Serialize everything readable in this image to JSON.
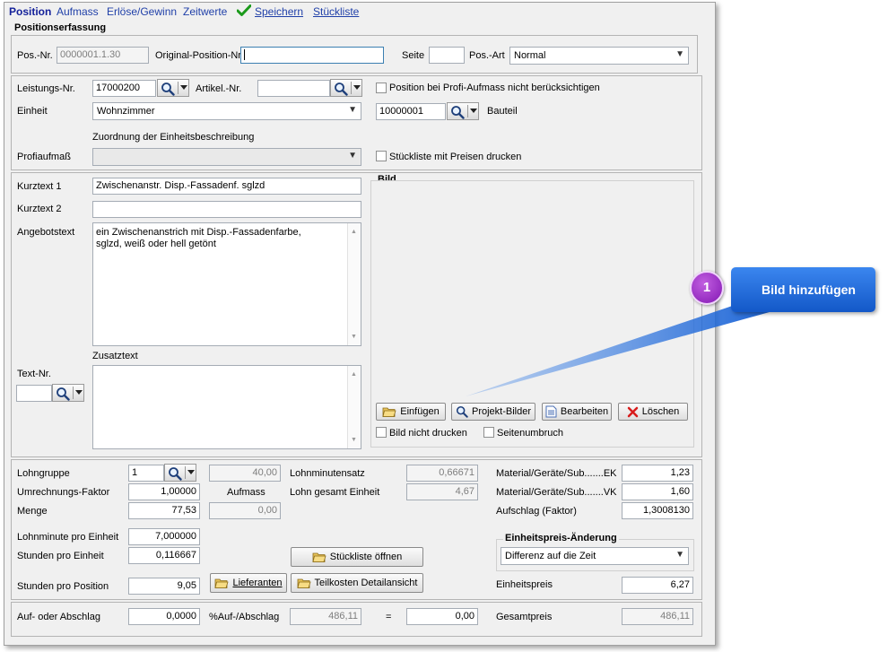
{
  "tabs": {
    "position": "Position",
    "aufmass": "Aufmass",
    "erloese": "Erlöse/Gewinn",
    "zeitwerte": "Zeitwerte",
    "speichern": "Speichern",
    "stueckliste": "Stückliste"
  },
  "positionserfassung": {
    "title": "Positionserfassung",
    "pos_nr_label": "Pos.-Nr.",
    "pos_nr_value": "0000001.1.30",
    "original_label": "Original-Position-Nr.",
    "original_value": "",
    "seite_label": "Seite",
    "seite_value": "",
    "pos_art_label": "Pos.-Art",
    "pos_art_value": "Normal"
  },
  "leistung": {
    "leistungs_nr_label": "Leistungs-Nr.",
    "leistungs_nr_value": "17000200",
    "artikel_nr_label": "Artikel.-Nr.",
    "artikel_nr_value": "",
    "profi_check_label": "Position bei Profi-Aufmass nicht berücksichtigen",
    "einheit_label": "Einheit",
    "einheit_value": "Wohnzimmer",
    "bauteil_value": "10000001",
    "bauteil_label": "Bauteil",
    "zuordnung_label": "Zuordnung der Einheitsbeschreibung",
    "profiaufmass_label": "Profiaufmaß",
    "profiaufmass_value": "",
    "stueckliste_check_label": "Stückliste mit Preisen drucken"
  },
  "texte": {
    "kurztext1_label": "Kurztext 1",
    "kurztext1_value": "Zwischenanstr. Disp.-Fassadenf. sglzd",
    "kurztext2_label": "Kurztext 2",
    "kurztext2_value": "",
    "angebotstext_label": "Angebotstext",
    "angebotstext_line1": "ein Zwischenanstrich mit Disp.-Fassadenfarbe,",
    "angebotstext_line2": "sglzd, weiß oder hell getönt",
    "zusatztext_label": "Zusatztext",
    "text_nr_label": "Text-Nr.",
    "text_nr_value": ""
  },
  "bild": {
    "title": "Bild",
    "einfuegen": "Einfügen",
    "projekt_bilder": "Projekt-Bilder",
    "bearbeiten": "Bearbeiten",
    "loeschen": "Löschen",
    "nicht_drucken": "Bild nicht drucken",
    "seitenumbruch": "Seitenumbruch"
  },
  "callout": {
    "number": "1",
    "text": "Bild hinzufügen"
  },
  "kalkulation": {
    "lohngruppe_label": "Lohngruppe",
    "lohngruppe_value": "1",
    "umrechnung_label": "Umrechnungs-Faktor",
    "umrechnung_value": "1,00000",
    "menge_label": "Menge",
    "menge_value": "77,53",
    "aufmass_top_value": "40,00",
    "aufmass_label": "Aufmass",
    "aufmass_bottom_value": "0,00",
    "lohnminutensatz_label": "Lohnminutensatz",
    "lohnminutensatz_value": "0,66671",
    "lohn_gesamt_label": "Lohn gesamt Einheit",
    "lohn_gesamt_value": "4,67",
    "mat_ek_label": "Material/Geräte/Sub.......EK",
    "mat_ek_value": "1,23",
    "mat_vk_label": "Material/Geräte/Sub.......VK",
    "mat_vk_value": "1,60",
    "aufschlag_label": "Aufschlag (Faktor)",
    "aufschlag_value": "1,3008130",
    "lohnminute_label": "Lohnminute pro Einheit",
    "lohnminute_value": "7,000000",
    "stunden_einheit_label": "Stunden pro Einheit",
    "stunden_einheit_value": "0,116667",
    "stunden_position_label": "Stunden pro Position",
    "stunden_position_value": "9,05",
    "stueckliste_oeffnen": "Stückliste öffnen",
    "lieferanten": "Lieferanten",
    "teilkosten": "Teilkosten Detailansicht",
    "ep_aenderung_title": "Einheitspreis-Änderung",
    "ep_aenderung_value": "Differenz auf die Zeit",
    "einheitspreis_label": "Einheitspreis",
    "einheitspreis_value": "6,27"
  },
  "summen": {
    "auf_abschlag_label": "Auf- oder Abschlag",
    "auf_abschlag_value": "0,0000",
    "prozent_label": "%Auf-/Abschlag",
    "prozent_value": "486,11",
    "gleich": "=",
    "ergebnis_value": "0,00",
    "gesamtpreis_label": "Gesamtpreis",
    "gesamtpreis_value": "486,11"
  },
  "colors": {
    "accent_blue": "#1358c8",
    "badge_purple": "#8217b3",
    "save_check_green": "#1b9a1b",
    "delete_red": "#d81b1b"
  }
}
